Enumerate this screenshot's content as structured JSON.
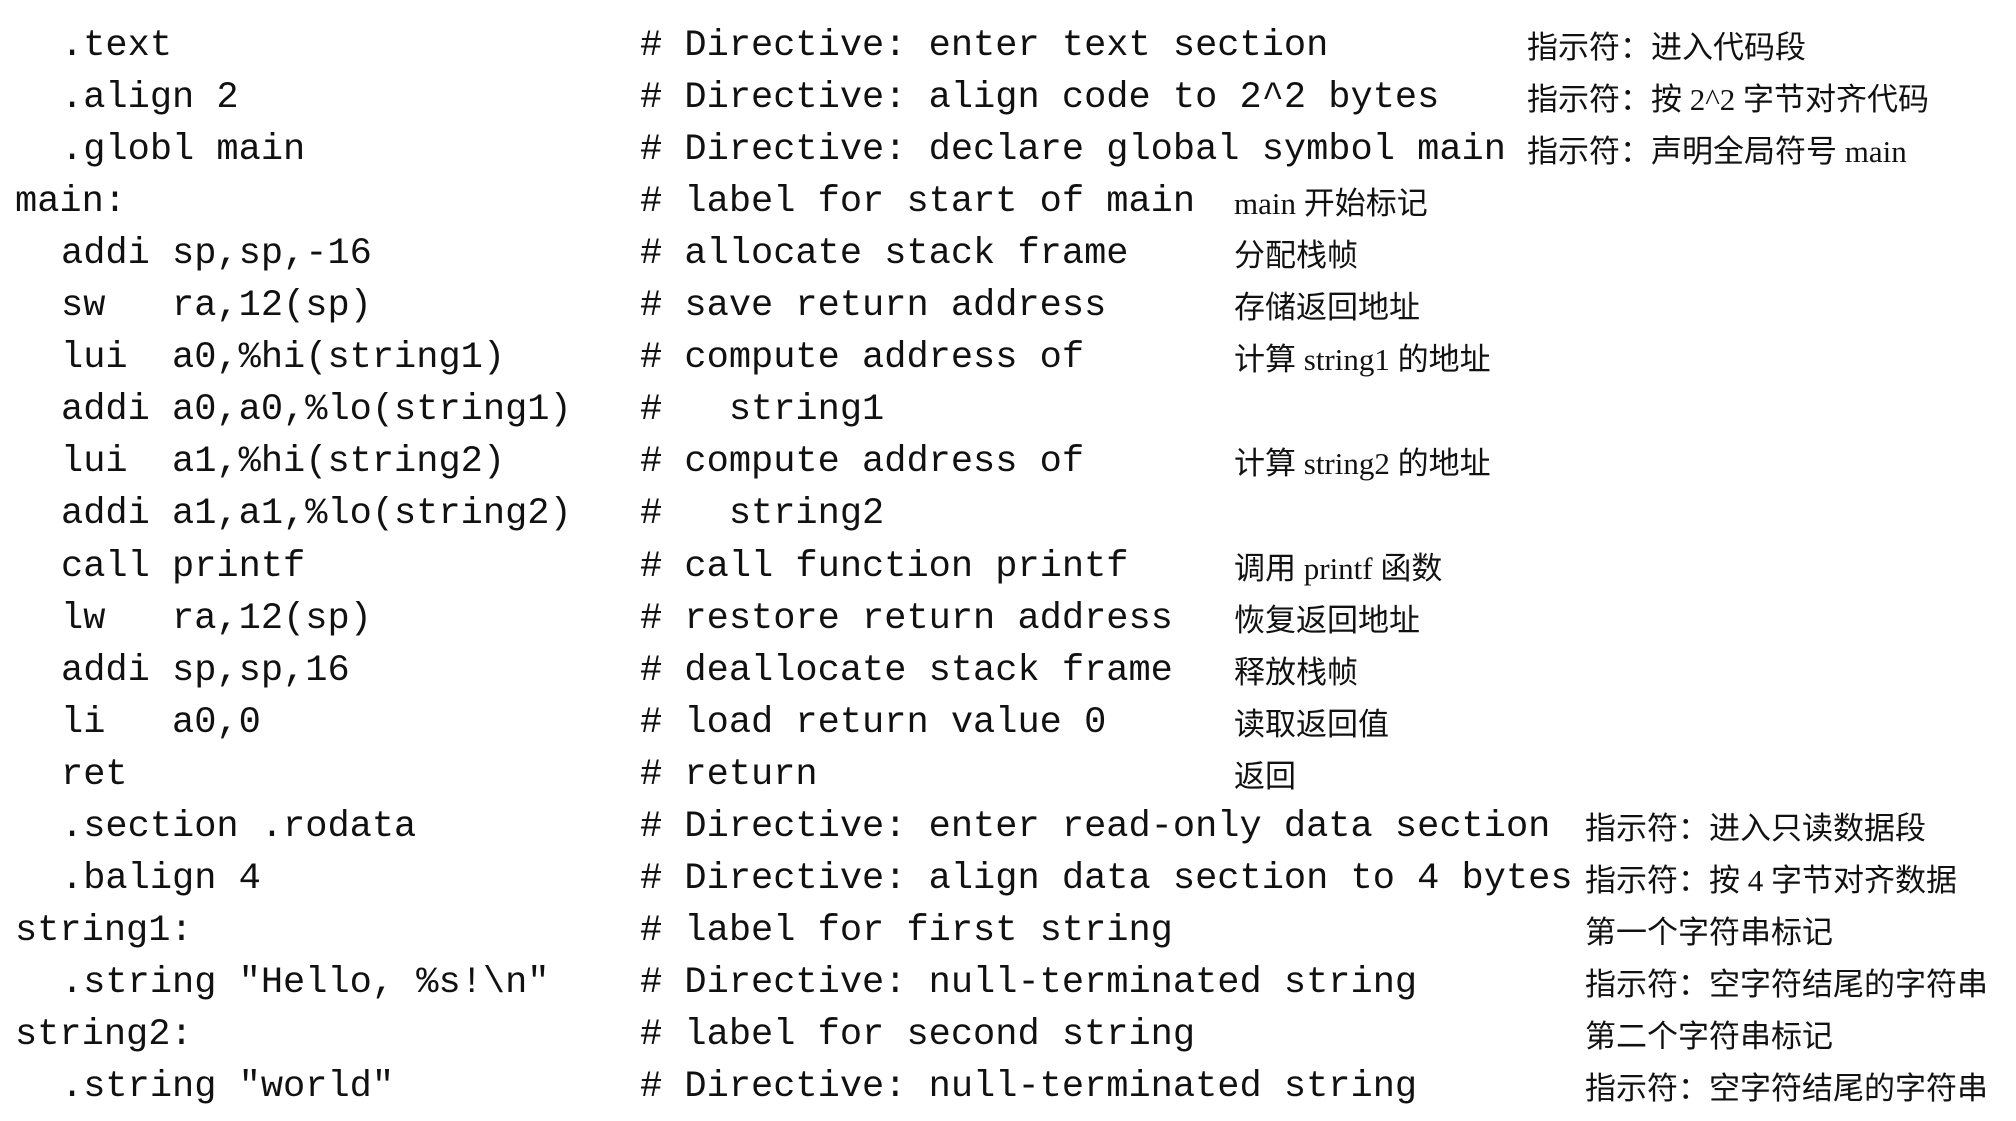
{
  "lines": [
    {
      "code": ".text",
      "label": false,
      "comment": "# Directive: enter text section",
      "zh": "指示符：进入代码段",
      "zh_col": "B"
    },
    {
      "code": ".align 2",
      "label": false,
      "comment": "# Directive: align code to 2^2 bytes",
      "zh": "指示符：按 2^2 字节对齐代码",
      "zh_col": "B"
    },
    {
      "code": ".globl main",
      "label": false,
      "comment": "# Directive: declare global symbol main",
      "zh": "指示符：声明全局符号 main",
      "zh_col": "B"
    },
    {
      "code": "main:",
      "label": true,
      "comment": "# label for start of main",
      "zh": "main 开始标记",
      "zh_col": "A"
    },
    {
      "code": "addi sp,sp,-16",
      "label": false,
      "comment": "# allocate stack frame",
      "zh": "分配栈帧",
      "zh_col": "A"
    },
    {
      "code": "sw   ra,12(sp)",
      "label": false,
      "comment": "# save return address",
      "zh": "存储返回地址",
      "zh_col": "A"
    },
    {
      "code": "lui  a0,%hi(string1)",
      "label": false,
      "comment": "# compute address of",
      "zh": "计算 string1 的地址",
      "zh_col": "A"
    },
    {
      "code": "addi a0,a0,%lo(string1)",
      "label": false,
      "comment": "#   string1",
      "zh": "",
      "zh_col": "A"
    },
    {
      "code": "lui  a1,%hi(string2)",
      "label": false,
      "comment": "# compute address of",
      "zh": "计算 string2 的地址",
      "zh_col": "A"
    },
    {
      "code": "addi a1,a1,%lo(string2)",
      "label": false,
      "comment": "#   string2",
      "zh": "",
      "zh_col": "A"
    },
    {
      "code": "call printf",
      "label": false,
      "comment": "# call function printf",
      "zh": "调用 printf 函数",
      "zh_col": "A"
    },
    {
      "code": "lw   ra,12(sp)",
      "label": false,
      "comment": "# restore return address",
      "zh": "恢复返回地址",
      "zh_col": "A"
    },
    {
      "code": "addi sp,sp,16",
      "label": false,
      "comment": "# deallocate stack frame",
      "zh": "释放栈帧",
      "zh_col": "A"
    },
    {
      "code": "li   a0,0",
      "label": false,
      "comment": "# load return value 0",
      "zh": "读取返回值",
      "zh_col": "A"
    },
    {
      "code": "ret",
      "label": false,
      "comment": "# return",
      "zh": "返回",
      "zh_col": "A"
    },
    {
      "code": ".section .rodata",
      "label": false,
      "comment": "# Directive: enter read-only data section",
      "zh": "指示符：进入只读数据段",
      "zh_col": "C"
    },
    {
      "code": ".balign 4",
      "label": false,
      "comment": "# Directive: align data section to 4 bytes",
      "zh": "指示符：按 4 字节对齐数据",
      "zh_col": "C"
    },
    {
      "code": "string1:",
      "label": true,
      "comment": "# label for first string",
      "zh": "第一个字符串标记",
      "zh_col": "C"
    },
    {
      "code": ".string \"Hello, %s!\\n\"",
      "label": false,
      "comment": "# Directive: null-terminated string",
      "zh": "指示符：空字符结尾的字符串",
      "zh_col": "C"
    },
    {
      "code": "string2:",
      "label": true,
      "comment": "# label for second string",
      "zh": "第二个字符串标记",
      "zh_col": "C"
    },
    {
      "code": ".string \"world\"",
      "label": false,
      "comment": "# Directive: null-terminated string",
      "zh": "指示符：空字符结尾的字符串",
      "zh_col": "C"
    }
  ]
}
